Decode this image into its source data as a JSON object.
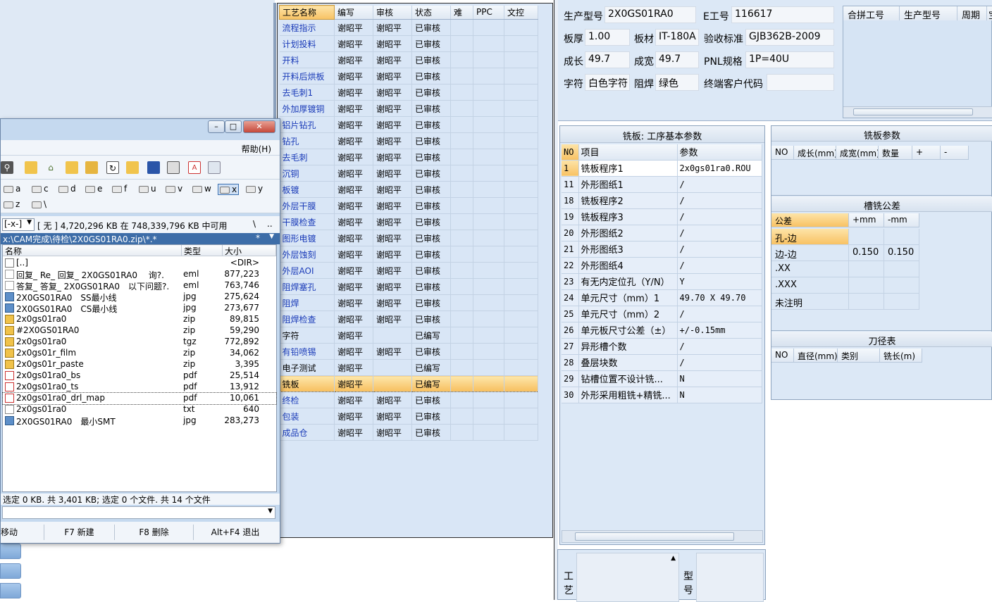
{
  "process_table": {
    "headers": [
      "工艺名称",
      "编写",
      "审核",
      "状态",
      "难",
      "PPC",
      "文控"
    ],
    "rows": [
      {
        "name": "流程指示",
        "writer": "谢昭平",
        "reviewer": "谢昭平",
        "status": "已审核"
      },
      {
        "name": "计划投料",
        "writer": "谢昭平",
        "reviewer": "谢昭平",
        "status": "已审核"
      },
      {
        "name": "开料",
        "writer": "谢昭平",
        "reviewer": "谢昭平",
        "status": "已审核"
      },
      {
        "name": "开料后烘板",
        "writer": "谢昭平",
        "reviewer": "谢昭平",
        "status": "已审核"
      },
      {
        "name": "去毛刺1",
        "writer": "谢昭平",
        "reviewer": "谢昭平",
        "status": "已审核"
      },
      {
        "name": "外加厚镀铜",
        "writer": "谢昭平",
        "reviewer": "谢昭平",
        "status": "已审核"
      },
      {
        "name": "铝片钻孔",
        "writer": "谢昭平",
        "reviewer": "谢昭平",
        "status": "已审核"
      },
      {
        "name": "钻孔",
        "writer": "谢昭平",
        "reviewer": "谢昭平",
        "status": "已审核"
      },
      {
        "name": "去毛刺",
        "writer": "谢昭平",
        "reviewer": "谢昭平",
        "status": "已审核"
      },
      {
        "name": "沉铜",
        "writer": "谢昭平",
        "reviewer": "谢昭平",
        "status": "已审核"
      },
      {
        "name": "板镀",
        "writer": "谢昭平",
        "reviewer": "谢昭平",
        "status": "已审核"
      },
      {
        "name": "外层干膜",
        "writer": "谢昭平",
        "reviewer": "谢昭平",
        "status": "已审核"
      },
      {
        "name": "干膜检查",
        "writer": "谢昭平",
        "reviewer": "谢昭平",
        "status": "已审核"
      },
      {
        "name": "图形电镀",
        "writer": "谢昭平",
        "reviewer": "谢昭平",
        "status": "已审核"
      },
      {
        "name": "外层蚀刻",
        "writer": "谢昭平",
        "reviewer": "谢昭平",
        "status": "已审核"
      },
      {
        "name": "外层AOI",
        "writer": "谢昭平",
        "reviewer": "谢昭平",
        "status": "已审核"
      },
      {
        "name": "阻焊塞孔",
        "writer": "谢昭平",
        "reviewer": "谢昭平",
        "status": "已审核"
      },
      {
        "name": "阻焊",
        "writer": "谢昭平",
        "reviewer": "谢昭平",
        "status": "已审核"
      },
      {
        "name": "阻焊检查",
        "writer": "谢昭平",
        "reviewer": "谢昭平",
        "status": "已审核"
      },
      {
        "name": "字符",
        "writer": "谢昭平",
        "reviewer": "",
        "status": "已编写"
      },
      {
        "name": "有铅喷锡",
        "writer": "谢昭平",
        "reviewer": "谢昭平",
        "status": "已审核"
      },
      {
        "name": "电子测试",
        "writer": "谢昭平",
        "reviewer": "",
        "status": "已编写"
      },
      {
        "name": "铣板",
        "writer": "谢昭平",
        "reviewer": "",
        "status": "已编写"
      },
      {
        "name": "终检",
        "writer": "谢昭平",
        "reviewer": "谢昭平",
        "status": "已审核"
      },
      {
        "name": "包装",
        "writer": "谢昭平",
        "reviewer": "谢昭平",
        "status": "已审核"
      },
      {
        "name": "成品仓",
        "writer": "谢昭平",
        "reviewer": "谢昭平",
        "status": "已审核"
      }
    ]
  },
  "product_info": {
    "model_label": "生产型号",
    "model": "2X0GS01RA0",
    "eno_label": "E工号",
    "eno": "116617",
    "thickness_label": "板厚",
    "thickness": "1.00",
    "material_label": "板材",
    "material": "IT-180A",
    "standard_label": "验收标准",
    "standard": "GJB362B-2009",
    "length_label": "成长",
    "length": "49.7",
    "width_label": "成宽",
    "width": "49.7",
    "pnl_label": "PNL规格",
    "pnl": "1P=40U",
    "char_label": "字符",
    "char": "白色字符",
    "mask_label": "阻焊",
    "mask": "绿色",
    "customer_label": "终端客户代码",
    "customer": ""
  },
  "merge_panel": {
    "headers": [
      "合拼工号",
      "生产型号",
      "周期",
      "宝"
    ]
  },
  "mill_params": {
    "title": "铣板: 工序基本参数",
    "headers": [
      "NO",
      "项目",
      "参数"
    ],
    "rows": [
      {
        "no": "1",
        "item": "铣板程序1",
        "value": "2x0gs01ra0.ROU"
      },
      {
        "no": "11",
        "item": "外形图纸1",
        "value": "/"
      },
      {
        "no": "18",
        "item": "铣板程序2",
        "value": "/"
      },
      {
        "no": "19",
        "item": "铣板程序3",
        "value": "/"
      },
      {
        "no": "20",
        "item": "外形图纸2",
        "value": "/"
      },
      {
        "no": "21",
        "item": "外形图纸3",
        "value": "/"
      },
      {
        "no": "22",
        "item": "外形图纸4",
        "value": "/"
      },
      {
        "no": "23",
        "item": "有无内定位孔（Y/N）",
        "value": "Y"
      },
      {
        "no": "24",
        "item": "单元尺寸（mm）1",
        "value": "49.70 X 49.70"
      },
      {
        "no": "25",
        "item": "单元尺寸（mm）2",
        "value": "/"
      },
      {
        "no": "26",
        "item": "单元板尺寸公差（±）",
        "value": "+/-0.15mm"
      },
      {
        "no": "27",
        "item": "异形槽个数",
        "value": "/"
      },
      {
        "no": "28",
        "item": "叠层块数",
        "value": "/"
      },
      {
        "no": "29",
        "item": "钻槽位置不设计铣...",
        "value": "N"
      },
      {
        "no": "30",
        "item": "外形采用粗铣+精铣...",
        "value": "N"
      }
    ]
  },
  "mill_board_params": {
    "title": "铣板参数",
    "headers": [
      "NO",
      "成长(mm)",
      "成宽(mm)",
      "数量",
      "+",
      "-"
    ]
  },
  "slot_tolerance": {
    "title": "槽铣公差",
    "headers": [
      "公差",
      "+mm",
      "-mm"
    ],
    "rows": [
      {
        "name": "孔-边",
        "plus": "",
        "minus": ""
      },
      {
        "name": "边-边",
        "plus": "0.150",
        "minus": "0.150"
      },
      {
        "name": ".XX",
        "plus": "",
        "minus": ""
      },
      {
        "name": ".XXX",
        "plus": "",
        "minus": ""
      },
      {
        "name": "未注明",
        "plus": "",
        "minus": ""
      }
    ]
  },
  "tool_table": {
    "title": "刀径表",
    "headers": [
      "NO",
      "直径(mm)",
      "类别",
      "铣长(m)"
    ]
  },
  "bottom_labels": {
    "process_label": "工艺",
    "model_label": "型号"
  },
  "file_manager": {
    "menu_help": "帮助(H)",
    "drives": [
      "a",
      "c",
      "d",
      "e",
      "f",
      "u",
      "v",
      "w",
      "x",
      "y",
      "z",
      "\\"
    ],
    "selected_drive": "x",
    "drive_combo": "[-x-]",
    "disk_info": "[ 无 ]  4,720,296 KB 在 748,339,796 KB 中可用",
    "path_btn1": "\\",
    "path_btn2": "..",
    "current_path": "x:\\CAM完成\\待检\\2X0GS01RA0.zip\\*.*",
    "path_star": "*",
    "columns": [
      "名称",
      "类型",
      "大小"
    ],
    "files": [
      {
        "name": "[..]",
        "ext": "",
        "size": "<DIR>",
        "icon": "up-dir"
      },
      {
        "name": "回复_ Re_ 回复_ 2X0GS01RA0　 询?.",
        "ext": "eml",
        "size": "877,223",
        "icon": "mail"
      },
      {
        "name": "答复_ 答复_ 2X0GS01RA0　以下问题?.",
        "ext": "eml",
        "size": "763,746",
        "icon": "mail"
      },
      {
        "name": "2X0GS01RA0　SS最小线",
        "ext": "jpg",
        "size": "275,624",
        "icon": "image"
      },
      {
        "name": "2X0GS01RA0　CS最小线",
        "ext": "jpg",
        "size": "273,677",
        "icon": "image"
      },
      {
        "name": "2x0gs01ra0",
        "ext": "zip",
        "size": "89,815",
        "icon": "archive"
      },
      {
        "name": "#2X0GS01RA0",
        "ext": "zip",
        "size": "59,290",
        "icon": "archive"
      },
      {
        "name": "2x0gs01ra0",
        "ext": "tgz",
        "size": "772,892",
        "icon": "archive"
      },
      {
        "name": "2x0gs01r_film",
        "ext": "zip",
        "size": "34,062",
        "icon": "archive"
      },
      {
        "name": "2x0gs01r_paste",
        "ext": "zip",
        "size": "3,395",
        "icon": "archive"
      },
      {
        "name": "2x0gs01ra0_bs",
        "ext": "pdf",
        "size": "25,514",
        "icon": "pdf"
      },
      {
        "name": "2x0gs01ra0_ts",
        "ext": "pdf",
        "size": "13,912",
        "icon": "pdf"
      },
      {
        "name": "2x0gs01ra0_drl_map",
        "ext": "pdf",
        "size": "10,061",
        "icon": "pdf"
      },
      {
        "name": "2x0gs01ra0",
        "ext": "txt",
        "size": "640",
        "icon": "text"
      },
      {
        "name": "2X0GS01RA0　最小SMT",
        "ext": "jpg",
        "size": "283,273",
        "icon": "image"
      }
    ],
    "status": "选定 0 KB. 共 3,401 KB; 选定 0 个文件. 共 14 个文件",
    "fkeys": [
      "移动",
      "F7 新建",
      "F8 删除",
      "Alt+F4 退出"
    ]
  },
  "colors": {
    "accent": "#f8c264",
    "link": "#1a3bb8",
    "panel": "#dce8f6"
  }
}
